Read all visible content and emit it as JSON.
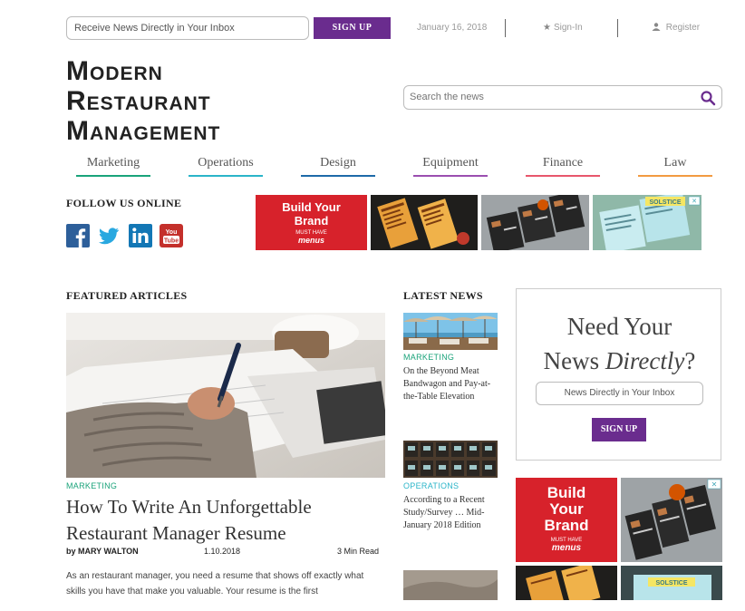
{
  "top_bar": {
    "newsletter_placeholder": "Receive News Directly in Your Inbox",
    "signup_label": "SIGN UP",
    "date": "January 16, 2018",
    "signin_label": "Sign-In",
    "register_label": "Register"
  },
  "logo": {
    "line1_cap": "M",
    "line1_rest": "ODERN",
    "line2_cap": "R",
    "line2_rest": "ESTAURANT",
    "line3_cap": "M",
    "line3_rest": "ANAGEMENT"
  },
  "search": {
    "placeholder": "Search the news"
  },
  "nav": [
    {
      "label": "Marketing",
      "color": "#1aa37a"
    },
    {
      "label": "Operations",
      "color": "#2bb5c9"
    },
    {
      "label": "Design",
      "color": "#1e6aa8"
    },
    {
      "label": "Equipment",
      "color": "#9b4fb0"
    },
    {
      "label": "Finance",
      "color": "#e8566c"
    },
    {
      "label": "Law",
      "color": "#f29b42"
    }
  ],
  "follow": {
    "title": "FOLLOW US ONLINE",
    "icons": [
      "facebook-icon",
      "twitter-icon",
      "linkedin-icon",
      "youtube-icon"
    ]
  },
  "ad_strip": {
    "build_line1": "Build Your",
    "build_line2": "Brand",
    "must_have": "MUST HAVE",
    "menus": "menus",
    "solstice": "SOLSTICE"
  },
  "featured": {
    "title": "FEATURED ARTICLES",
    "category": "MARKETING",
    "headline": "How To Write An Unforgettable Restaurant Manager Resume",
    "author": "by MARY WALTON",
    "date": "1.10.2018",
    "read_time": "3 Min Read",
    "excerpt": "As an restaurant manager, you need a resume that shows off exactly what skills you have that make you valuable. Your resume is the first"
  },
  "latest": {
    "title": "LATEST NEWS",
    "items": [
      {
        "category": "MARKETING",
        "category_color": "#1aa37a",
        "headline": "On the Beyond Meat Bandwagon and Pay-at-the-Table Elevation"
      },
      {
        "category": "OPERATIONS",
        "category_color": "#2bb5c9",
        "headline": "According to a Recent Study/Survey … Mid-January 2018 Edition"
      }
    ]
  },
  "newsletter_box": {
    "heading_line1": "Need Your",
    "heading_line2_a": "News ",
    "heading_line2_b": "Directly",
    "heading_line2_c": "?",
    "input_placeholder": "News Directly in Your Inbox",
    "signup_label": "SIGN UP"
  },
  "right_ad": {
    "line1": "Build",
    "line2": "Your",
    "line3": "Brand",
    "must_have": "MUST HAVE",
    "menus": "menus",
    "solstice": "SOLSTICE"
  },
  "colors": {
    "brand_purple": "#6a2c8e",
    "ad_red": "#d7222b"
  }
}
